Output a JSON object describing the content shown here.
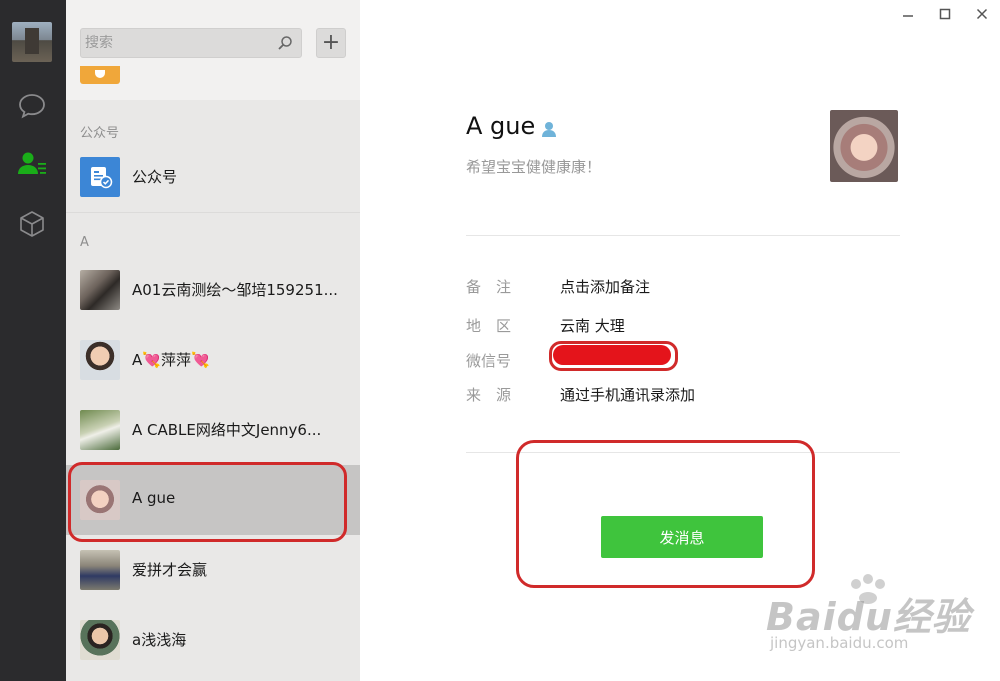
{
  "sidebar": {
    "items": [
      {
        "icon": "chat-icon"
      },
      {
        "icon": "contacts-icon",
        "active": true
      },
      {
        "icon": "favorites-cube-icon"
      }
    ]
  },
  "search": {
    "placeholder": "搜索",
    "value": ""
  },
  "add_button": {
    "label": "+"
  },
  "contacts": {
    "sections": [
      {
        "label": "公众号",
        "items": [
          {
            "name": "公众号"
          }
        ]
      },
      {
        "label": "A",
        "items": [
          {
            "name": "A01云南测绘～邹培159251..."
          },
          {
            "name": "A💘萍萍💘"
          },
          {
            "name": "A   CABLE网络中文Jenny6..."
          },
          {
            "name": "A gue",
            "selected": true
          },
          {
            "name": "爱拼才会赢"
          },
          {
            "name": "a浅浅海"
          }
        ]
      }
    ]
  },
  "window": {
    "minimize": "—",
    "maximize": "□",
    "close": "✕"
  },
  "profile": {
    "name": "A gue",
    "signature": "希望宝宝健健康康！",
    "fields": [
      {
        "label": "备　注",
        "value": "点击添加备注"
      },
      {
        "label": "地　区",
        "value": "云南 大理"
      },
      {
        "label": "微信号",
        "value": ""
      },
      {
        "label": "来　源",
        "value": "通过手机通讯录添加"
      }
    ],
    "send_button": "发消息"
  },
  "colors": {
    "accent_green": "#3fc43d",
    "annotation_red": "#d02a2a",
    "rail_bg": "#2b2b2d"
  },
  "watermark": {
    "brand": "Baidu经验",
    "url": "jingyan.baidu.com"
  }
}
